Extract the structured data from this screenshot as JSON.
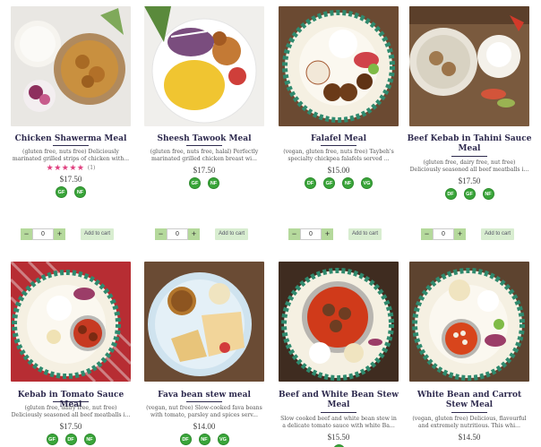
{
  "products": [
    {
      "title": "Chicken Shawerma Meal",
      "desc_lines": [
        "(gluten free, nuts free) Deliciously",
        "marinated grilled strips of chicken with..."
      ],
      "rating_stars": "★★★★★",
      "rating_count": "(1)",
      "price": "$17.50",
      "badges": [
        "GF",
        "NF"
      ],
      "qty": "0",
      "add_label": "Add to cart",
      "icon": "chicken-shawerma-plate-photo"
    },
    {
      "title": "Sheesh Tawook Meal",
      "desc_lines": [
        "(gluten free, nuts free, halal) Perfectly",
        "marinated grilled chicken breast wi..."
      ],
      "price": "$17.50",
      "badges": [
        "GF",
        "NF"
      ],
      "qty": "0",
      "add_label": "Add to cart",
      "icon": "sheesh-tawook-plate-photo"
    },
    {
      "title": "Falafel Meal",
      "desc_lines": [
        "(vegan, gluten free, nuts free) Taybeh's",
        "specialty chickpea falafels served ..."
      ],
      "price": "$15.00",
      "badges": [
        "DF",
        "GF",
        "NF",
        "VG"
      ],
      "qty": "0",
      "add_label": "Add to cart",
      "icon": "falafel-plate-photo"
    },
    {
      "title": "Beef Kebab in Tahini Sauce Meal",
      "desc_lines": [
        "(gluten free, dairy free, nut free)",
        "Deliciously seasoned all beef meatballs i..."
      ],
      "price": "$17.50",
      "badges": [
        "DF",
        "GF",
        "NF"
      ],
      "qty": "0",
      "add_label": "Add to cart",
      "icon": "beef-kebab-tahini-photo"
    },
    {
      "title": "Kebab in Tomato Sauce Meal",
      "desc_lines": [
        "(gluten free, dairy free, nut free)",
        "Deliciously seasoned all beef meatballs i..."
      ],
      "price": "$17.50",
      "badges": [
        "GF",
        "DF",
        "NF"
      ],
      "icon": "kebab-tomato-plate-photo"
    },
    {
      "title": "Fava bean stew meal",
      "desc_lines": [
        "(vegan, nut free) Slow-cooked fava beans",
        "with tomato, parsley and spices serv..."
      ],
      "price": "$14.00",
      "badges": [
        "DF",
        "NF",
        "VG"
      ],
      "icon": "fava-bean-stew-photo"
    },
    {
      "title": "Beef and White Bean Stew Meal",
      "desc_lines": [
        "Slow cooked beef and white bean stew in",
        "a delicate tomato sauce with white Ba..."
      ],
      "price": "$15.50",
      "badges": [
        "GF"
      ],
      "icon": "beef-white-bean-stew-photo"
    },
    {
      "title": "White Bean and Carrot Stew Meal",
      "desc_lines": [
        "(vegan, gluten free) Delicious, flavourful",
        "and extremely nutritious. This whi..."
      ],
      "price": "$14.50",
      "badges": [],
      "icon": "white-bean-carrot-stew-photo"
    }
  ],
  "qty_minus": "−",
  "qty_plus": "+"
}
